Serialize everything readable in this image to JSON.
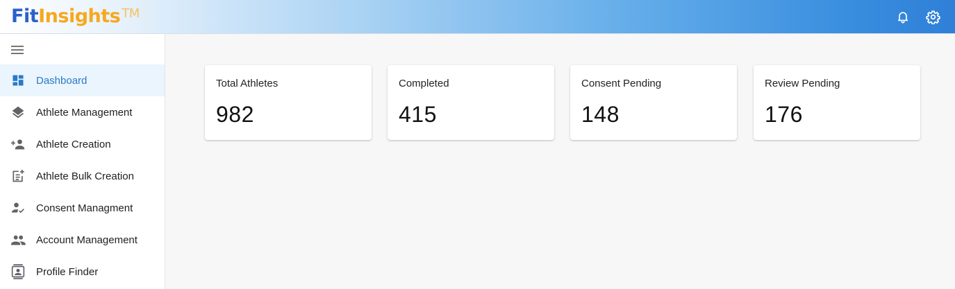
{
  "header": {
    "logo_fit": "Fit",
    "logo_insights": "Insights",
    "logo_tm": "TM",
    "icons": [
      "bell-icon",
      "gear-icon"
    ]
  },
  "sidebar": {
    "toggle_icon": "hamburger-menu-icon",
    "items": [
      {
        "label": "Dashboard",
        "icon": "dashboard-icon",
        "active": true
      },
      {
        "label": "Athlete Management",
        "icon": "layers-icon",
        "active": false
      },
      {
        "label": "Athlete Creation",
        "icon": "person-add-icon",
        "active": false
      },
      {
        "label": "Athlete Bulk Creation",
        "icon": "post-add-icon",
        "active": false
      },
      {
        "label": "Consent Managment",
        "icon": "person-check-icon",
        "active": false
      },
      {
        "label": "Account Management",
        "icon": "people-icon",
        "active": false
      },
      {
        "label": "Profile Finder",
        "icon": "contact-card-icon",
        "active": false
      }
    ]
  },
  "cards": [
    {
      "title": "Total Athletes",
      "value": "982"
    },
    {
      "title": "Completed",
      "value": "415"
    },
    {
      "title": "Consent Pending",
      "value": "148"
    },
    {
      "title": "Review Pending",
      "value": "176"
    }
  ],
  "colors": {
    "accent": "#2979c8",
    "active_bg": "#eaf5fd",
    "logo_blue": "#2a62c9",
    "logo_orange": "#f6a81f",
    "icon_grey": "#5f6368"
  }
}
